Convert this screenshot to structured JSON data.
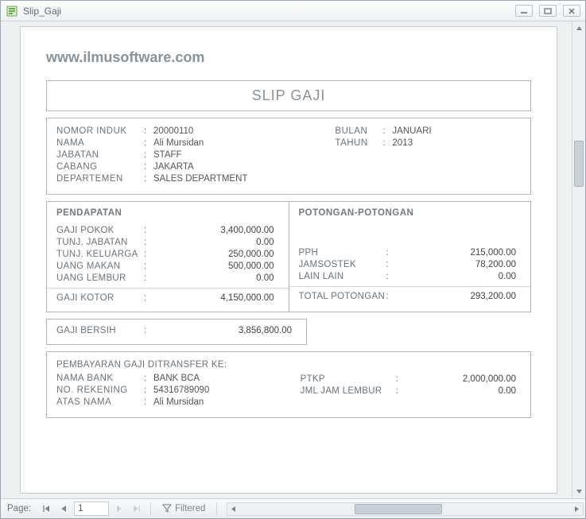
{
  "window": {
    "title": "Slip_Gaji"
  },
  "header": {
    "website": "www.ilmusoftware.com",
    "doc_title": "SLIP GAJI"
  },
  "info": {
    "labels": {
      "nomor_induk": "NOMOR INDUK",
      "nama": "NAMA",
      "jabatan": "JABATAN",
      "cabang": "CABANG",
      "departemen": "DEPARTEMEN",
      "bulan": "BULAN",
      "tahun": "TAHUN"
    },
    "values": {
      "nomor_induk": "20000110",
      "nama": "Ali Mursidan",
      "jabatan": "STAFF",
      "cabang": "JAKARTA",
      "departemen": "SALES DEPARTMENT",
      "bulan": "JANUARI",
      "tahun": "2013"
    }
  },
  "earnings": {
    "title": "PENDAPATAN",
    "rows": {
      "gaji_pokok": {
        "label": "GAJI POKOK",
        "value": "3,400,000.00"
      },
      "tunj_jabatan": {
        "label": "TUNJ. JABATAN",
        "value": "0.00"
      },
      "tunj_keluarga": {
        "label": "TUNJ. KELUARGA",
        "value": "250,000.00"
      },
      "uang_makan": {
        "label": "UANG MAKAN",
        "value": "500,000.00"
      },
      "uang_lembur": {
        "label": "UANG LEMBUR",
        "value": "0.00"
      }
    },
    "total": {
      "label": "GAJI KOTOR",
      "value": "4,150,000.00"
    }
  },
  "deductions": {
    "title": "POTONGAN-POTONGAN",
    "rows": {
      "pph": {
        "label": "PPH",
        "value": "215,000.00"
      },
      "jamsostek": {
        "label": "JAMSOSTEK",
        "value": "78,200.00"
      },
      "lain": {
        "label": "LAIN LAIN",
        "value": "0.00"
      }
    },
    "total": {
      "label": "TOTAL POTONGAN",
      "value": "293,200.00"
    }
  },
  "net": {
    "label": "GAJI BERSIH",
    "value": "3,856,800.00"
  },
  "payment": {
    "heading": "PEMBAYARAN GAJI DITRANSFER KE:",
    "labels": {
      "bank": "NAMA BANK",
      "rekening": "NO. REKENING",
      "atas_nama": "ATAS NAMA",
      "ptkp": "PTKP",
      "jml_jam_lembur": "JML JAM LEMBUR"
    },
    "values": {
      "bank": "BANK BCA",
      "rekening": "54316789090",
      "atas_nama": "Ali Mursidan",
      "ptkp": "2,000,000.00",
      "jml_jam_lembur": "0.00"
    }
  },
  "status": {
    "page_label": "Page:",
    "page_value": "1",
    "filter_label": "Filtered"
  },
  "colon": ":"
}
